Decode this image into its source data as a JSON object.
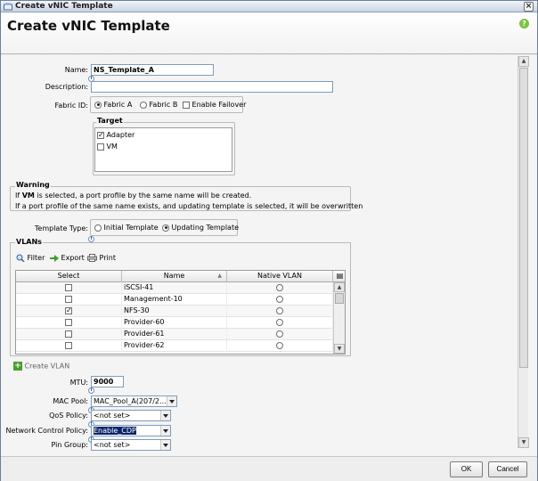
{
  "window": {
    "title": "Create vNIC Template",
    "header": "Create vNIC Template"
  },
  "form": {
    "name_label": "Name:",
    "name_value": "NS_Template_A",
    "description_label": "Description:",
    "description_value": "",
    "fabric_label": "Fabric ID:",
    "fabric_options": [
      "Fabric A",
      "Fabric B"
    ],
    "fabric_selected": "Fabric A",
    "enable_failover_label": "Enable Failover",
    "target_legend": "Target",
    "target_items": [
      {
        "label": "Adapter",
        "checked": true
      },
      {
        "label": "VM",
        "checked": false
      }
    ],
    "warning_legend": "Warning",
    "warning_line1_prefix": "If ",
    "warning_line1_bold": "VM",
    "warning_line1_suffix": " is selected, a port profile by the same name will be created.",
    "warning_line2": "If a port profile of the same name exists, and updating template is selected, it will be overwritten",
    "template_type_label": "Template Type:",
    "template_types": [
      "Initial Template",
      "Updating Template"
    ],
    "template_type_selected": "Updating Template"
  },
  "vlans": {
    "legend": "VLANs",
    "toolbar": {
      "filter": "Filter",
      "export": "Export",
      "print": "Print"
    },
    "columns": [
      "Select",
      "Name",
      "Native VLAN"
    ],
    "rows": [
      {
        "name": "iSCSI-41",
        "selected": false,
        "native": false
      },
      {
        "name": "Management-10",
        "selected": false,
        "native": false
      },
      {
        "name": "NFS-30",
        "selected": true,
        "native": false
      },
      {
        "name": "Provider-60",
        "selected": false,
        "native": false
      },
      {
        "name": "Provider-61",
        "selected": false,
        "native": false
      },
      {
        "name": "Provider-62",
        "selected": false,
        "native": false
      }
    ]
  },
  "create_vlan": "Create VLAN",
  "mtu": {
    "label": "MTU:",
    "value": "9000"
  },
  "mac_pool": {
    "label": "MAC Pool:",
    "value": "MAC_Pool_A(207/2..."
  },
  "qos_policy": {
    "label": "QoS Policy:",
    "value": "<not set>"
  },
  "network_control_policy": {
    "label": "Network Control Policy:",
    "value": "Enable_CDP"
  },
  "pin_group": {
    "label": "Pin Group:",
    "value": "<not set>"
  },
  "buttons": {
    "ok": "OK",
    "cancel": "Cancel"
  },
  "colors": {
    "titlebar": "#c9d3e2",
    "header_bg": "#ffffff",
    "selection": "#0a246a",
    "help_green": "#7bc143",
    "create_green": "#4aa02c"
  }
}
